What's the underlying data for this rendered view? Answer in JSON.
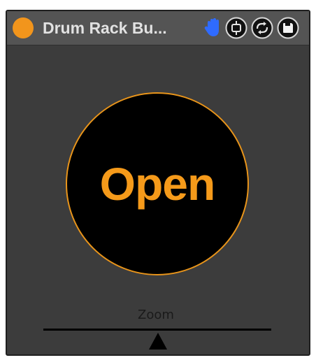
{
  "window": {
    "title": "Drum Rack Bu...",
    "accent_color": "#f2951c",
    "icons": {
      "power": "power-toggle-icon",
      "hand": "hand-icon",
      "map": "map-mode-icon",
      "hotswap": "hot-swap-icon",
      "save": "save-preset-icon"
    }
  },
  "main": {
    "open_button_label": "Open",
    "open_button_color": "#f59a1a"
  },
  "zoom": {
    "label": "Zoom"
  }
}
